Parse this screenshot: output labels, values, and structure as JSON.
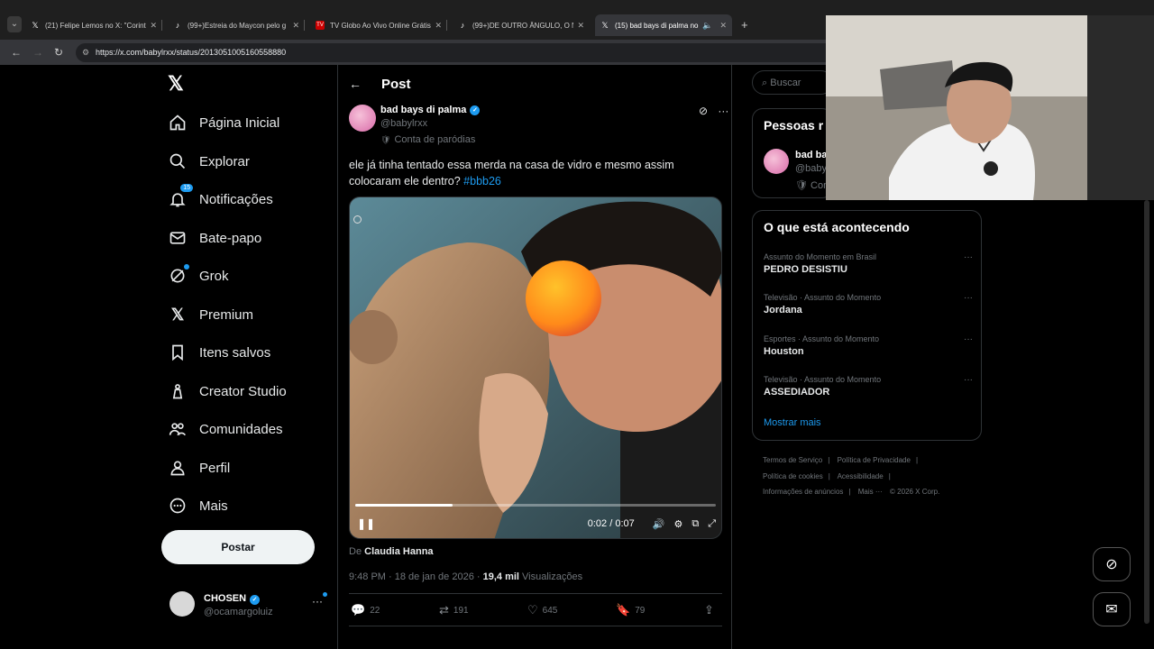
{
  "browser": {
    "tabs": [
      {
        "title": "(21) Felipe Lemos no X: \"Corinth",
        "icon": "x-logo-icon",
        "glyph": "𝕏"
      },
      {
        "title": "(99+)Estreia do Maycon pelo g",
        "icon": "tiktok-icon",
        "glyph": "♪"
      },
      {
        "title": "TV Globo Ao Vivo Online Grátis",
        "icon": "tv-icon",
        "glyph": "TV"
      },
      {
        "title": "(99+)DE OUTRO ÂNGULO, O N",
        "icon": "tiktok-icon",
        "glyph": "♪"
      },
      {
        "title": "(15) bad bays di palma no X",
        "icon": "x-logo-icon",
        "glyph": "𝕏"
      }
    ],
    "url": "https://x.com/babylrxx/status/2013051005160558880",
    "new_tab": "+"
  },
  "left_nav": {
    "logo": "𝕏",
    "items": [
      {
        "label": "Página Inicial",
        "icon": "home-icon",
        "glyph": "⌂"
      },
      {
        "label": "Explorar",
        "icon": "search-icon",
        "glyph": "⌕"
      },
      {
        "label": "Notificações",
        "icon": "bell-icon",
        "glyph": "🔔",
        "badge": "15"
      },
      {
        "label": "Bate-papo",
        "icon": "mail-icon",
        "glyph": "✉"
      },
      {
        "label": "Grok",
        "icon": "grok-icon",
        "glyph": "⊘"
      },
      {
        "label": "Premium",
        "icon": "x-logo-icon",
        "glyph": "𝕏"
      },
      {
        "label": "Itens salvos",
        "icon": "bookmark-icon",
        "glyph": "🔖"
      },
      {
        "label": "Creator Studio",
        "icon": "creator-icon",
        "glyph": "♙"
      },
      {
        "label": "Comunidades",
        "icon": "communities-icon",
        "glyph": "👥"
      },
      {
        "label": "Perfil",
        "icon": "person-icon",
        "glyph": "👤"
      },
      {
        "label": "Mais",
        "icon": "more-circle-icon",
        "glyph": "⊙"
      }
    ],
    "post_button": "Postar",
    "account": {
      "name": "CHOSEN",
      "handle": "@ocamargoluiz",
      "more": "···"
    }
  },
  "post": {
    "header_title": "Post",
    "author_name": "bad bays di palma",
    "author_handle": "@babylrxx",
    "parody_label": "Conta de paródias",
    "text": "ele já tinha tentado essa merda na casa de vidro e mesmo assim colocaram ele dentro?",
    "hashtag": "#bbb26",
    "video": {
      "time": "0:02 / 0:07",
      "progress": 0.27
    },
    "credit_prefix": "De",
    "credit_name": "Claudia Hanna",
    "timestamp": "9:48 PM · 18 de jan de 2026 ·",
    "views": "19,4 mil",
    "views_label": "Visualizações",
    "stats": {
      "replies": "22",
      "reposts": "191",
      "likes": "645",
      "bookmarks": "79"
    }
  },
  "sidebar": {
    "search_placeholder": "Buscar",
    "people_title": "Pessoas r",
    "people_name": "bad ba",
    "people_handle": "@baby",
    "people_parody": "Con",
    "trends_title": "O que está acontecendo",
    "trends": [
      {
        "context": "Assunto do Momento em Brasil",
        "name": "PEDRO DESISTIU"
      },
      {
        "context": "Televisão · Assunto do Momento",
        "name": "Jordana"
      },
      {
        "context": "Esportes · Assunto do Momento",
        "name": "Houston"
      },
      {
        "context": "Televisão · Assunto do Momento",
        "name": "ASSEDIADOR"
      }
    ],
    "show_more": "Mostrar mais",
    "footer": [
      "Termos de Serviço",
      "|",
      "Política de Privacidade",
      "|",
      "Política de cookies",
      "|",
      "Acessibilidade",
      "|",
      "Informações de anúncios",
      "|",
      "Mais ···",
      "© 2026 X Corp."
    ]
  },
  "colors": {
    "accent": "#1d9bf0",
    "background": "#000000",
    "border": "#2f3336",
    "muted": "#71767b"
  }
}
